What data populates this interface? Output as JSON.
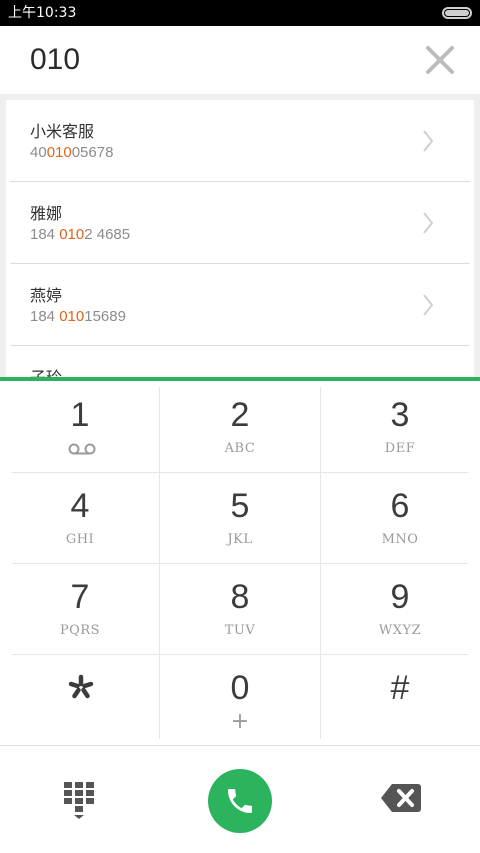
{
  "status_bar": {
    "time": "上午10:33"
  },
  "dialer": {
    "number": "010"
  },
  "results": [
    {
      "name": "小米客服",
      "number_parts": [
        "40",
        "010",
        "05678"
      ]
    },
    {
      "name": "雅娜",
      "number_parts": [
        "184 ",
        "010",
        "2 4685"
      ]
    },
    {
      "name": "燕婷",
      "number_parts": [
        "184 ",
        "010",
        "15689"
      ]
    },
    {
      "name": "子玲",
      "number_parts": [
        "",
        "",
        ""
      ]
    }
  ],
  "keypad": {
    "keys": [
      {
        "digit": "1",
        "letters": ""
      },
      {
        "digit": "2",
        "letters": "ABC"
      },
      {
        "digit": "3",
        "letters": "DEF"
      },
      {
        "digit": "4",
        "letters": "GHI"
      },
      {
        "digit": "5",
        "letters": "JKL"
      },
      {
        "digit": "6",
        "letters": "MNO"
      },
      {
        "digit": "7",
        "letters": "PQRS"
      },
      {
        "digit": "8",
        "letters": "TUV"
      },
      {
        "digit": "9",
        "letters": "WXYZ"
      },
      {
        "digit": "",
        "letters": ""
      },
      {
        "digit": "0",
        "letters": "+"
      },
      {
        "digit": "#",
        "letters": ""
      }
    ]
  },
  "colors": {
    "accent": "#2bb35d",
    "highlight": "#e2621b"
  },
  "icons": {
    "clear": "close-icon",
    "chevron": "chevron-right-icon",
    "voicemail": "voicemail-icon",
    "star": "star-key-icon",
    "keypad_toggle": "dialpad-icon",
    "call": "phone-icon",
    "backspace": "backspace-icon"
  }
}
